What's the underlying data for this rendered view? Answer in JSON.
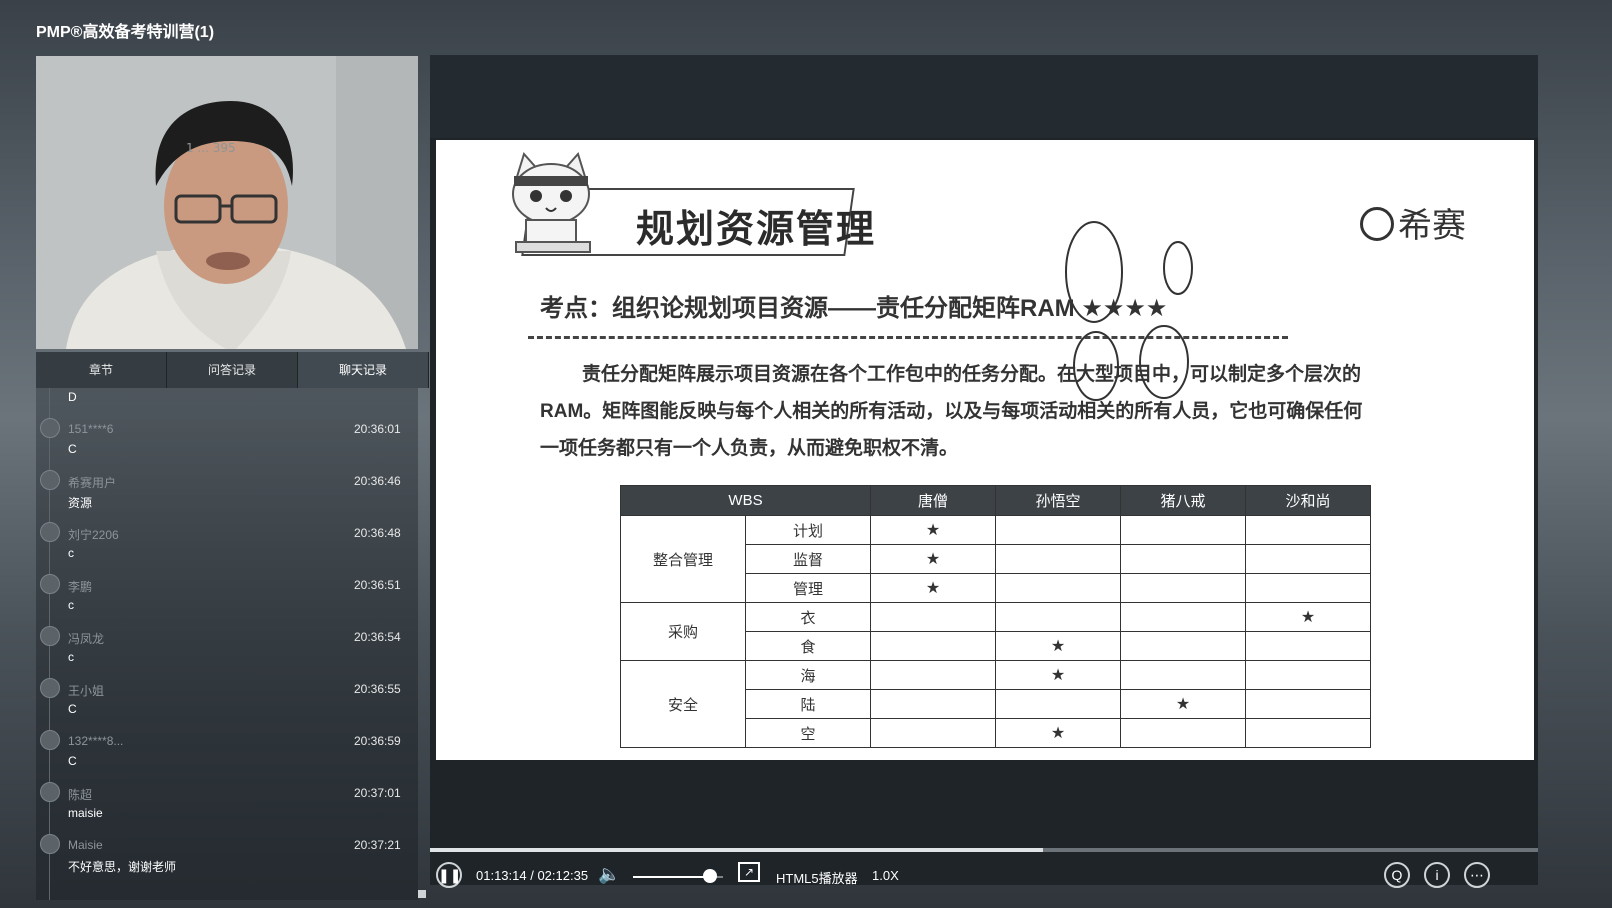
{
  "app": {
    "title": "PMP®高效备考特训营(1)"
  },
  "webcam": {
    "watermark": "1 ... 395"
  },
  "tabs": [
    {
      "label": "章节",
      "active": false
    },
    {
      "label": "问答记录",
      "active": false
    },
    {
      "label": "聊天记录",
      "active": true
    }
  ],
  "chat": {
    "partial_top": "D",
    "messages": [
      {
        "user": "151****6",
        "time": "20:36:01",
        "text": "C"
      },
      {
        "user": "希赛用户",
        "time": "20:36:46",
        "text": "资源"
      },
      {
        "user": "刘宁2206",
        "time": "20:36:48",
        "text": "c"
      },
      {
        "user": "李鹏",
        "time": "20:36:51",
        "text": "c"
      },
      {
        "user": "冯凤龙",
        "time": "20:36:54",
        "text": "c"
      },
      {
        "user": "王小姐",
        "time": "20:36:55",
        "text": "C"
      },
      {
        "user": "132****8...",
        "time": "20:36:59",
        "text": "C"
      },
      {
        "user": "陈超",
        "time": "20:37:01",
        "text": "maisie"
      },
      {
        "user": "Maisie",
        "time": "20:37:21",
        "text": "不好意思，谢谢老师"
      }
    ]
  },
  "slide": {
    "title": "规划资源管理",
    "brand": "希赛",
    "kaodian": "考点：组织论规划项目资源——责任分配矩阵RAM ★★★★",
    "paragraph_line1": "责任分配矩阵展示项目资源在各个工作包中的任务分配。在大型项目中，可以制定多个层次的",
    "paragraph_line2": "RAM。矩阵图能反映与每个人相关的所有活动，以及与每项活动相关的所有人员，它也可确保任何",
    "paragraph_line3": "一项任务都只有一个人负责，从而避免职权不清。",
    "table": {
      "headers": [
        "WBS",
        "唐僧",
        "孙悟空",
        "猪八戒",
        "沙和尚"
      ],
      "groups": [
        {
          "name": "整合管理",
          "rows": [
            {
              "task": "计划",
              "marks": [
                "★",
                "",
                "",
                ""
              ]
            },
            {
              "task": "监督",
              "marks": [
                "★",
                "",
                "",
                ""
              ]
            },
            {
              "task": "管理",
              "marks": [
                "★",
                "",
                "",
                ""
              ]
            }
          ]
        },
        {
          "name": "采购",
          "rows": [
            {
              "task": "衣",
              "marks": [
                "",
                "",
                "",
                "★"
              ]
            },
            {
              "task": "食",
              "marks": [
                "",
                "★",
                "",
                ""
              ]
            }
          ]
        },
        {
          "name": "安全",
          "rows": [
            {
              "task": "海",
              "marks": [
                "",
                "★",
                "",
                ""
              ]
            },
            {
              "task": "陆",
              "marks": [
                "",
                "",
                "★",
                ""
              ]
            },
            {
              "task": "空",
              "marks": [
                "",
                "★",
                "",
                ""
              ]
            }
          ]
        }
      ]
    }
  },
  "player": {
    "current_time": "01:13:14",
    "separator": " / ",
    "total_time": "02:12:35",
    "progress_fraction": 0.553,
    "volume_fraction": 0.85,
    "player_name": "HTML5播放器",
    "speed": "1.0X"
  }
}
